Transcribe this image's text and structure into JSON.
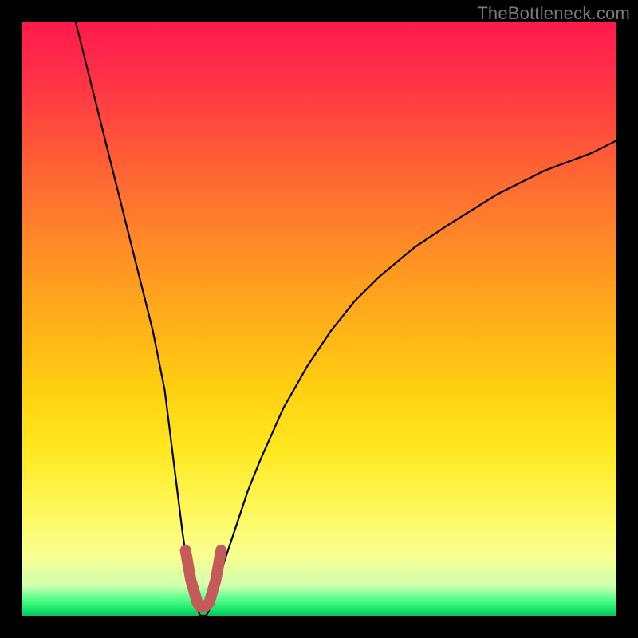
{
  "watermark": {
    "text": "TheBottleneck.com"
  },
  "colors": {
    "curve": "#000000",
    "marker": "#c45a5a",
    "background_black": "#000000"
  },
  "chart_data": {
    "type": "line",
    "title": "",
    "xlabel": "",
    "ylabel": "",
    "xlim": [
      0,
      100
    ],
    "ylim": [
      0,
      100
    ],
    "grid": false,
    "legend": false,
    "series": [
      {
        "name": "bottleneck-curve",
        "x": [
          9,
          10,
          12,
          14,
          16,
          18,
          20,
          22,
          24,
          25,
          26,
          27,
          28,
          29,
          30,
          31,
          32,
          33,
          34,
          36,
          38,
          40,
          44,
          48,
          52,
          56,
          60,
          66,
          72,
          80,
          88,
          96,
          100
        ],
        "y": [
          100,
          96,
          88,
          80,
          72,
          64,
          56,
          48,
          38,
          30,
          22,
          14,
          7,
          2,
          0,
          0,
          2,
          5,
          9,
          15,
          21,
          26,
          35,
          42,
          48,
          53,
          57,
          62,
          66,
          71,
          75,
          78,
          80
        ]
      }
    ],
    "markers": [
      {
        "name": "trough-marker",
        "path_xy": [
          [
            27.5,
            11
          ],
          [
            28.4,
            6
          ],
          [
            29.5,
            2.2
          ],
          [
            30.0,
            1.5
          ],
          [
            30.8,
            1.5
          ],
          [
            31.5,
            2.2
          ],
          [
            32.6,
            6
          ],
          [
            33.5,
            11
          ]
        ],
        "stroke_width_px": 14
      }
    ]
  }
}
